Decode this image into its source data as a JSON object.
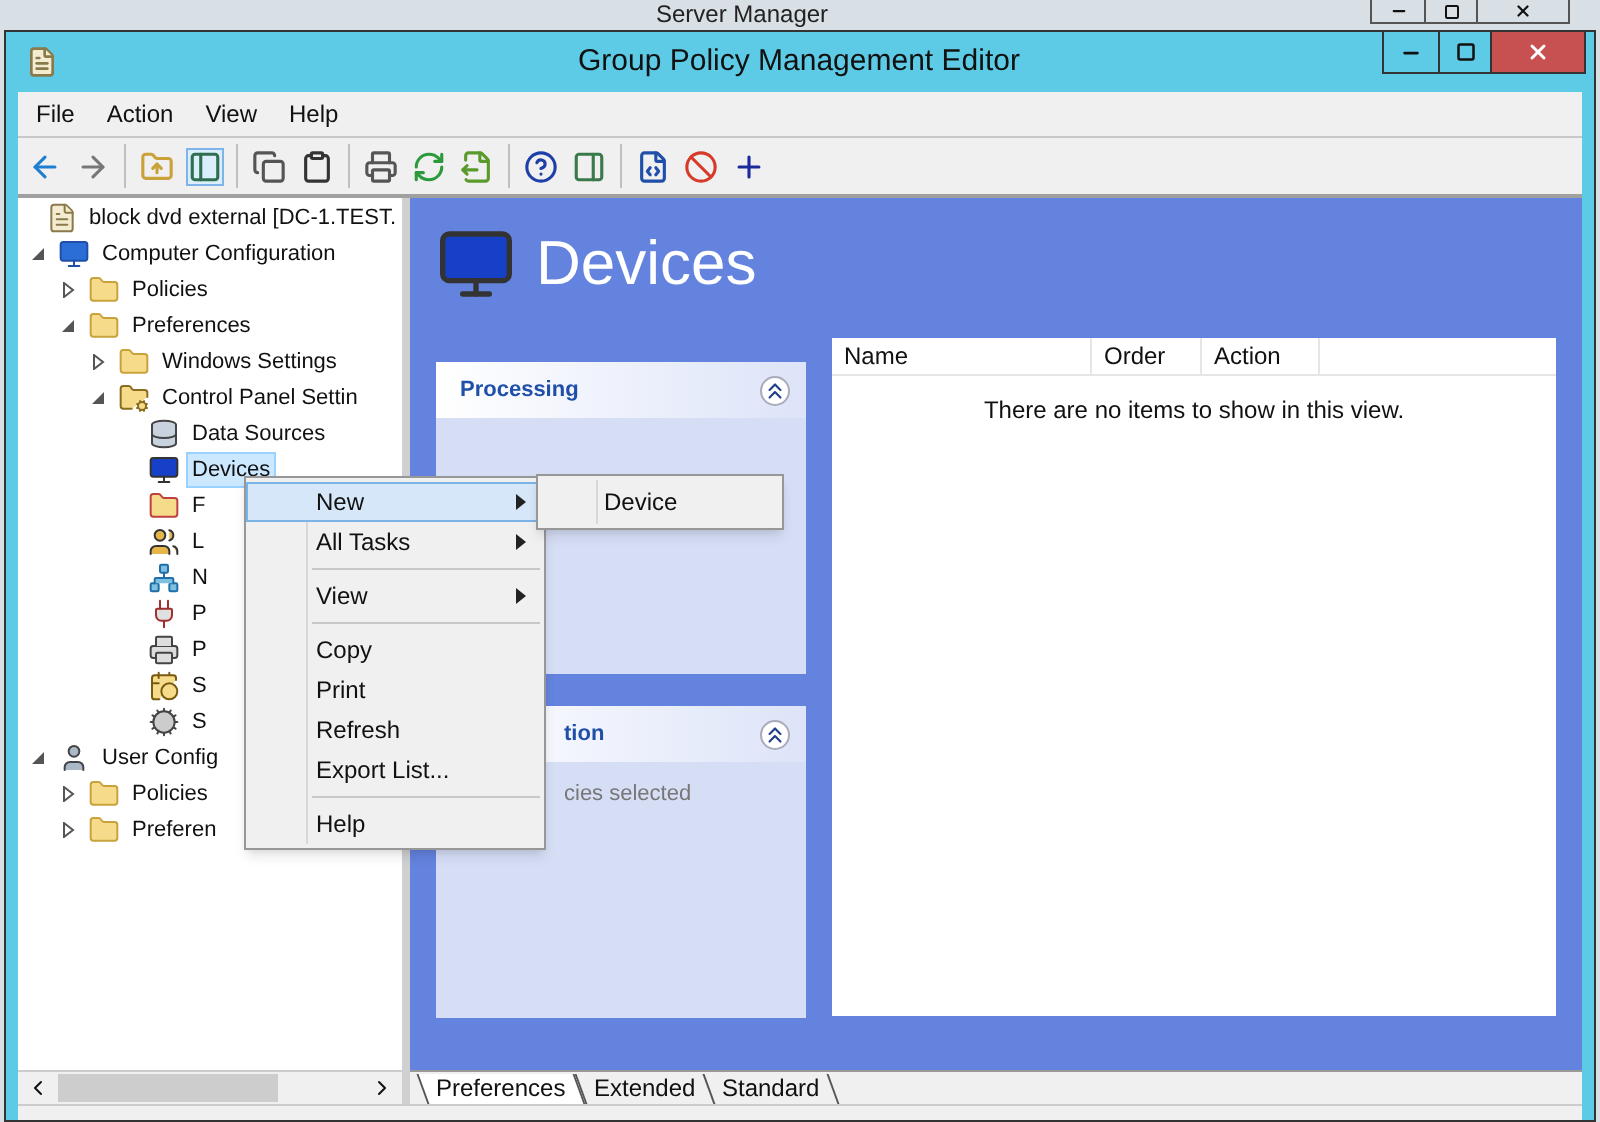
{
  "background_window": {
    "title": "Server Manager"
  },
  "window": {
    "title": "Group Policy Management Editor"
  },
  "menu_bar": [
    "File",
    "Action",
    "View",
    "Help"
  ],
  "tree": [
    {
      "label": "block dvd external  [DC-1.TEST.",
      "kind": "scroll",
      "selected": false
    },
    {
      "label": "Computer Configuration",
      "kind": "computer",
      "expanded": true,
      "selected": false,
      "children": [
        {
          "label": "Policies",
          "kind": "folder",
          "expanded": false,
          "selected": false
        },
        {
          "label": "Preferences",
          "kind": "folder",
          "expanded": true,
          "selected": false,
          "children": [
            {
              "label": "Windows Settings",
              "kind": "folder",
              "expanded": false,
              "selected": false
            },
            {
              "label": "Control Panel Settin",
              "kind": "cpfolder",
              "expanded": true,
              "selected": false,
              "children": [
                {
                  "label": "Data Sources",
                  "kind": "datasource",
                  "selected": false
                },
                {
                  "label": "Devices",
                  "kind": "device",
                  "selected": true
                },
                {
                  "label": "F",
                  "kind": "folderopts",
                  "selected": false
                },
                {
                  "label": "L",
                  "kind": "users",
                  "selected": false
                },
                {
                  "label": "N",
                  "kind": "network",
                  "selected": false
                },
                {
                  "label": "P",
                  "kind": "power",
                  "selected": false
                },
                {
                  "label": "P",
                  "kind": "printer",
                  "selected": false
                },
                {
                  "label": "S",
                  "kind": "task",
                  "selected": false
                },
                {
                  "label": "S",
                  "kind": "gears",
                  "selected": false
                }
              ]
            }
          ]
        }
      ]
    },
    {
      "label": "User Config",
      "kind": "user",
      "expanded": true,
      "selected": false,
      "children": [
        {
          "label": "Policies",
          "kind": "folder",
          "expanded": false,
          "selected": false
        },
        {
          "label": "Preferen",
          "kind": "folder",
          "expanded": false,
          "selected": false
        }
      ]
    }
  ],
  "header": {
    "title": "Devices"
  },
  "panels": [
    {
      "title": "Processing"
    },
    {
      "title": "tion",
      "body": "cies selected"
    }
  ],
  "table": {
    "columns": [
      "Name",
      "Order",
      "Action"
    ],
    "empty_text": "There are no items to show in this view."
  },
  "bottom_tabs": [
    {
      "label": "Preferences",
      "selected": true
    },
    {
      "label": "Extended",
      "selected": false
    },
    {
      "label": "Standard",
      "selected": false
    }
  ],
  "context_menu": {
    "items": [
      {
        "label": "New",
        "kind": "submenu",
        "selected": true
      },
      {
        "label": "All Tasks",
        "kind": "submenu",
        "selected": false
      },
      {
        "kind": "separator"
      },
      {
        "label": "View",
        "kind": "submenu",
        "selected": false
      },
      {
        "kind": "separator"
      },
      {
        "label": "Copy",
        "kind": "item",
        "selected": false
      },
      {
        "label": "Print",
        "kind": "item",
        "selected": false
      },
      {
        "label": "Refresh",
        "kind": "item",
        "selected": false
      },
      {
        "label": "Export List...",
        "kind": "item",
        "selected": false
      },
      {
        "kind": "separator"
      },
      {
        "label": "Help",
        "kind": "item",
        "selected": false
      }
    ],
    "submenu": [
      {
        "label": "Device"
      }
    ]
  }
}
